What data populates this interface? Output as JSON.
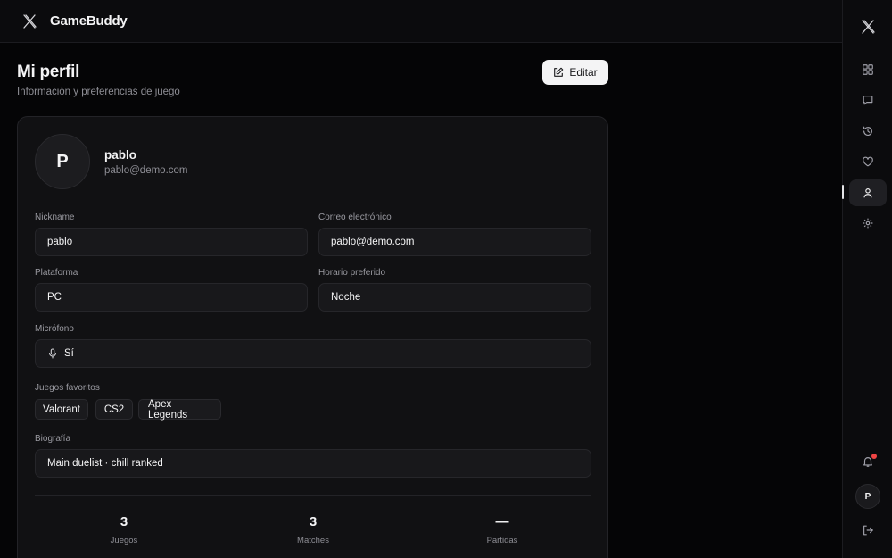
{
  "app": {
    "brand": "GameBuddy",
    "logo_icon": "x-logo-icon"
  },
  "header": {
    "title": "Mi perfil",
    "subtitle": "Información y preferencias de juego",
    "edit_label": "Editar"
  },
  "profile": {
    "avatar_initial": "P",
    "name": "pablo",
    "email": "pablo@demo.com"
  },
  "fields": {
    "nickname": {
      "label": "Nickname",
      "value": "pablo"
    },
    "email": {
      "label": "Correo electrónico",
      "value": "pablo@demo.com"
    },
    "platform": {
      "label": "Plataforma",
      "value": "PC"
    },
    "schedule": {
      "label": "Horario preferido",
      "value": "Noche"
    },
    "microphone": {
      "label": "Micrófono",
      "value": "Sí"
    },
    "favorite_games": {
      "label": "Juegos favoritos",
      "items": [
        "Valorant",
        "CS2",
        "Apex Legends"
      ]
    },
    "bio": {
      "label": "Biografía",
      "value": "Main duelist · chill ranked"
    }
  },
  "stats": [
    {
      "value": "3",
      "label": "Juegos"
    },
    {
      "value": "3",
      "label": "Matches"
    },
    {
      "value": "—",
      "label": "Partidas"
    }
  ],
  "rail": {
    "items": [
      "dashboard-icon",
      "chat-icon",
      "history-icon",
      "heart-icon",
      "user-icon",
      "settings-icon"
    ],
    "active": "user-icon",
    "avatar_initial": "P",
    "has_notification": true
  },
  "colors": {
    "background": "#050506",
    "surface": "#111113",
    "accent": "#f4f4f5",
    "notification": "#ef4444"
  }
}
